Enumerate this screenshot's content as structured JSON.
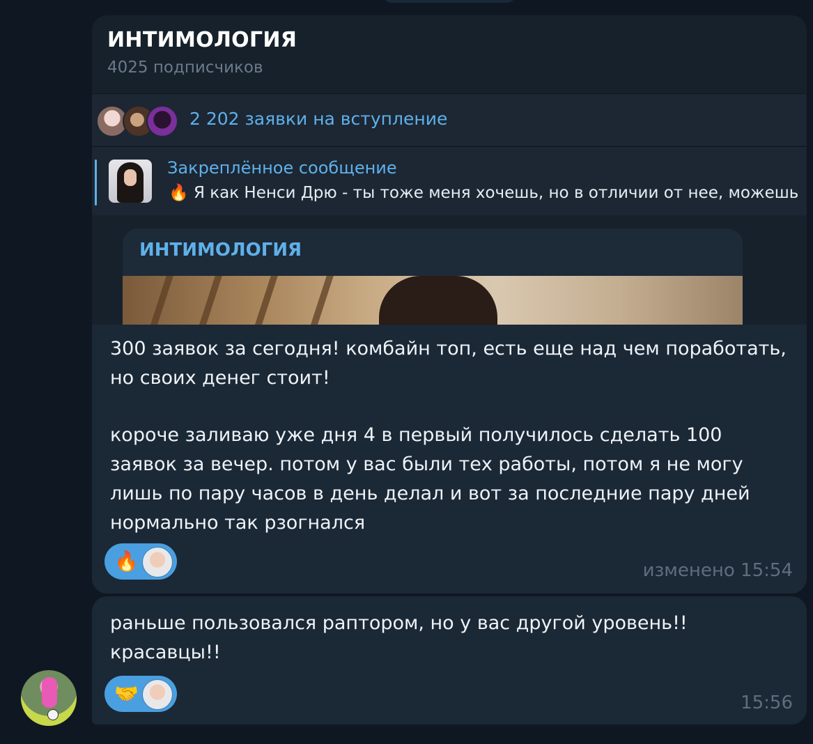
{
  "channel": {
    "title": "ИНТИМОЛОГИЯ",
    "subscribers": "4025 подписчиков"
  },
  "join_requests": {
    "label": "2 202 заявки на вступление"
  },
  "pinned": {
    "title": "Закреплённое сообщение",
    "text": "🔥 Я как Ненси Дрю - ты тоже меня хочешь, но в отличии от нее, можешь"
  },
  "forwarded": {
    "channel_name": "ИНТИМОЛОГИЯ"
  },
  "messages": [
    {
      "paragraph_1": "300 заявок за сегодня! комбайн топ, есть еще над чем поработать, но своих денег стоит!",
      "paragraph_2": "короче заливаю уже дня 4 в первый получилось сделать 100 заявок за вечер. потом у вас были тех работы, потом я не могу лишь по пару часов в день делал и вот за последние пару дней нормально так рзогнался",
      "reaction_emoji": "🔥",
      "reaction_emoji_icon": "fire-icon",
      "time": "изменено 15:54"
    },
    {
      "text": "раньше пользовался раптором, но у вас другой уровень!! красавцы!!",
      "reaction_emoji": "🤝",
      "reaction_emoji_icon": "handshake-icon",
      "time": "15:56"
    }
  ],
  "colors": {
    "background": "#0f1822",
    "bubble": "#1b2836",
    "accent": "#5fb0ea",
    "reaction_pill": "#4a9fe0",
    "muted": "#5e6e7f"
  }
}
